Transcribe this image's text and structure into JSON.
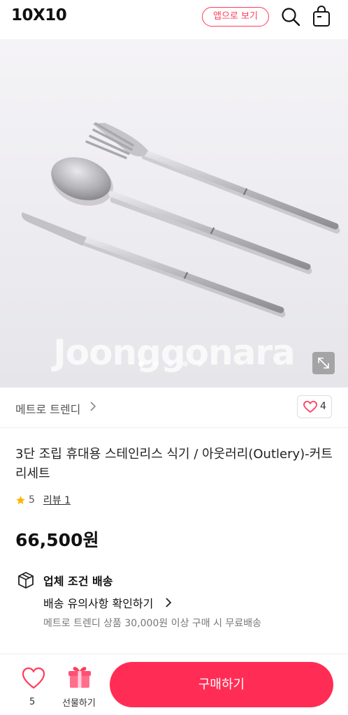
{
  "header": {
    "logo": "10X10",
    "app_button": "앱으로 보기"
  },
  "hero": {
    "watermark": "Joonggonara",
    "image_description": "silver fork spoon knife set",
    "dots_total": 5,
    "active_dot": 1
  },
  "brand": {
    "name": "메트로 트렌디",
    "likes": "4"
  },
  "product": {
    "title": "3단 조립 휴대용 스테인리스 식기 / 아웃러리(Outlery)-커트리세트",
    "rating": "5",
    "review_label": "리뷰 1",
    "price": "66,500원"
  },
  "shipping": {
    "title": "업체 조건 배송",
    "notice": "배송 유의사항 확인하기",
    "free_condition": "메트로 트렌디 상품 30,000원 이상 구매 시 무료배송"
  },
  "bottom": {
    "wish_count": "5",
    "gift_label": "선물하기",
    "buy_label": "구매하기"
  },
  "colors": {
    "accent": "#ff2d55",
    "star": "#ffb400"
  }
}
